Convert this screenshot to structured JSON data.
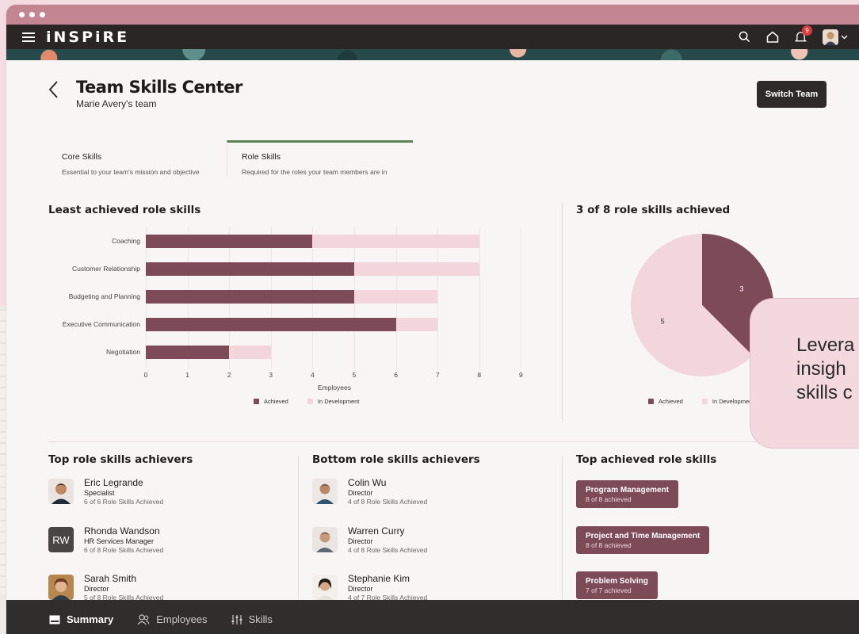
{
  "app": {
    "brand": "iNSPiRE",
    "notification_count": "9"
  },
  "header": {
    "title": "Team Skills Center",
    "subtitle": "Marie Avery's team",
    "switch_team": "Switch Team"
  },
  "tabs": [
    {
      "label": "Core Skills",
      "description": "Essential to your team's mission and objective",
      "active": false
    },
    {
      "label": "Role Skills",
      "description": "Required for the roles your team members are in",
      "active": true
    }
  ],
  "bar_section": {
    "title": "Least achieved role skills"
  },
  "pie_section": {
    "title": "3 of 8 role skills achieved"
  },
  "chart_data": [
    {
      "type": "bar",
      "orientation": "horizontal",
      "stacked": true,
      "title": "Least achieved role skills",
      "categories": [
        "Coaching",
        "Customer Relationship",
        "Budgeting and Planning",
        "Executive Communication",
        "Negotiation"
      ],
      "series": [
        {
          "name": "Achieved",
          "values": [
            4,
            5,
            5,
            6,
            2
          ],
          "color": "#7d4a57"
        },
        {
          "name": "In Development",
          "values": [
            4,
            3,
            2,
            1,
            1
          ],
          "color": "#f2d6dc"
        }
      ],
      "xlabel": "Employees",
      "xlim": [
        0,
        9
      ],
      "xticks": [
        "0",
        "1",
        "2",
        "3",
        "4",
        "5",
        "6",
        "7",
        "8",
        "9"
      ],
      "legend": "bottom",
      "grid": true
    },
    {
      "type": "pie",
      "title": "3 of 8 role skills achieved",
      "slices": [
        {
          "name": "Achieved",
          "value": 3,
          "color": "#7d4a57"
        },
        {
          "name": "In Development",
          "value": 5,
          "color": "#f2d6dc"
        }
      ],
      "labels": [
        "3",
        "5"
      ],
      "legend": "bottom"
    }
  ],
  "callout": {
    "lines": [
      "Levera",
      "insigh",
      "skills c"
    ]
  },
  "top_achievers": {
    "title": "Top role skills achievers",
    "people": [
      {
        "name": "Eric Legrande",
        "role": "Specialist",
        "count": "6 of 6 Role Skills Achieved"
      },
      {
        "name": "Rhonda Wandson",
        "role": "HR Services Manager",
        "count": "6 of 8 Role Skills Achieved",
        "initials": "RW"
      },
      {
        "name": "Sarah Smith",
        "role": "Director",
        "count": "5 of 8 Role Skills Achieved"
      }
    ]
  },
  "bottom_achievers": {
    "title": "Bottom role skills achievers",
    "people": [
      {
        "name": "Colin Wu",
        "role": "Director",
        "count": "4 of 8 Role Skills Achieved"
      },
      {
        "name": "Warren Curry",
        "role": "Director",
        "count": "4 of 8 Role Skills Achieved"
      },
      {
        "name": "Stephanie Kim",
        "role": "Director",
        "count": "4 of 7 Role Skills Achieved"
      }
    ]
  },
  "top_skills": {
    "title": "Top achieved role skills",
    "items": [
      {
        "name": "Program Management",
        "count": "8 of 8 achieved"
      },
      {
        "name": "Project and Time Management",
        "count": "8 of 8 achieved"
      },
      {
        "name": "Problem Solving",
        "count": "7 of 7 achieved"
      }
    ]
  },
  "bottom_nav": [
    {
      "label": "Summary",
      "icon": "summary-icon",
      "active": true
    },
    {
      "label": "Employees",
      "icon": "employees-icon",
      "active": false
    },
    {
      "label": "Skills",
      "icon": "skills-icon",
      "active": false
    }
  ]
}
